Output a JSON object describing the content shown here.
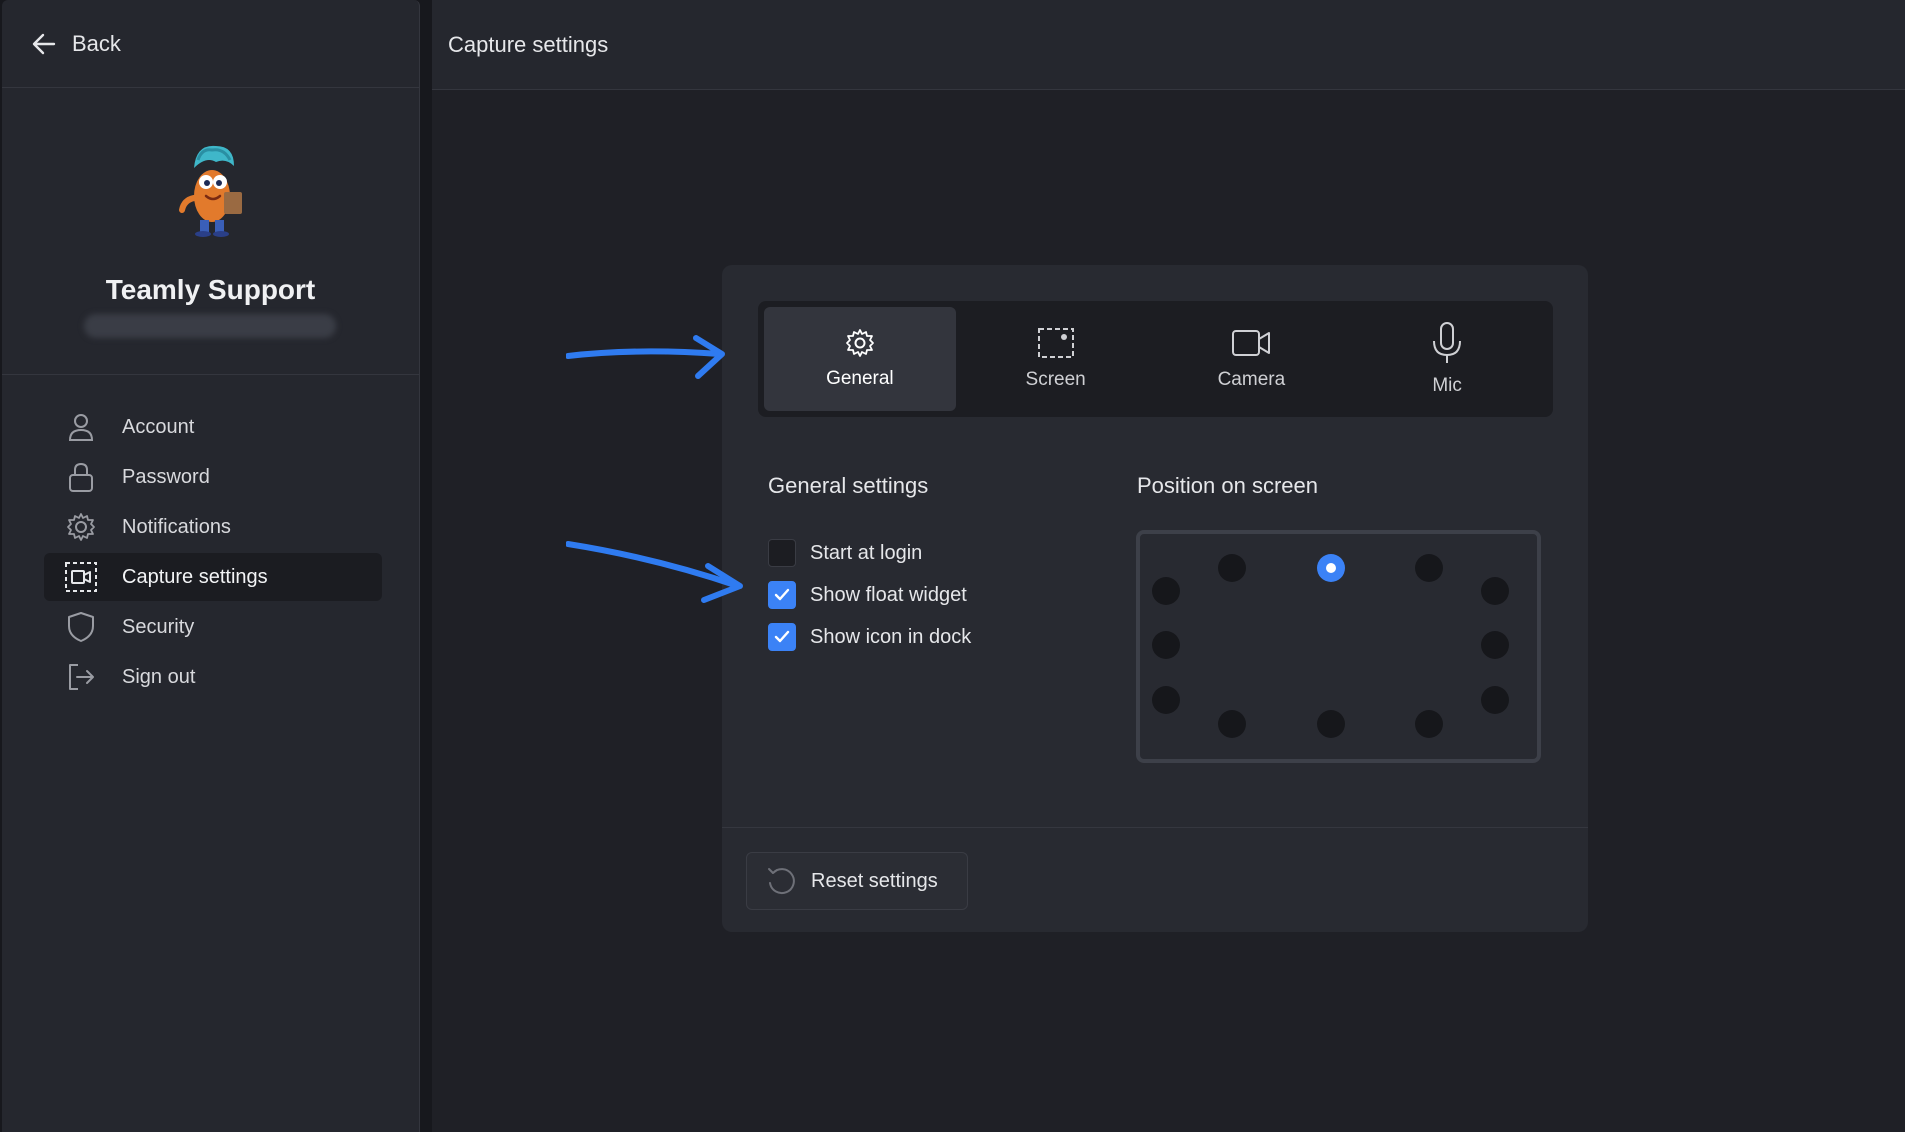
{
  "sidebar": {
    "back_label": "Back",
    "profile": {
      "name": "Teamly Support"
    },
    "menu": [
      {
        "label": "Account",
        "icon": "user-icon"
      },
      {
        "label": "Password",
        "icon": "lock-icon"
      },
      {
        "label": "Notifications",
        "icon": "gear-icon"
      },
      {
        "label": "Capture settings",
        "icon": "capture-icon",
        "active": true
      },
      {
        "label": "Security",
        "icon": "shield-icon"
      },
      {
        "label": "Sign out",
        "icon": "sign-out-icon"
      }
    ]
  },
  "main": {
    "title": "Capture settings",
    "tabs": [
      {
        "label": "General",
        "icon": "gear-icon",
        "active": true
      },
      {
        "label": "Screen",
        "icon": "screen-select-icon"
      },
      {
        "label": "Camera",
        "icon": "camera-icon"
      },
      {
        "label": "Mic",
        "icon": "mic-icon"
      }
    ],
    "general_settings": {
      "title": "General settings",
      "options": [
        {
          "label": "Start at login",
          "checked": false
        },
        {
          "label": "Show float widget",
          "checked": true
        },
        {
          "label": "Show icon in dock",
          "checked": true
        }
      ]
    },
    "position": {
      "title": "Position on screen",
      "selected": "top-center"
    },
    "reset_label": "Reset settings"
  },
  "colors": {
    "accent": "#3b82f6",
    "background": "#1f2026",
    "panel": "#282a31",
    "annotation_arrow": "#2f7bf0"
  }
}
